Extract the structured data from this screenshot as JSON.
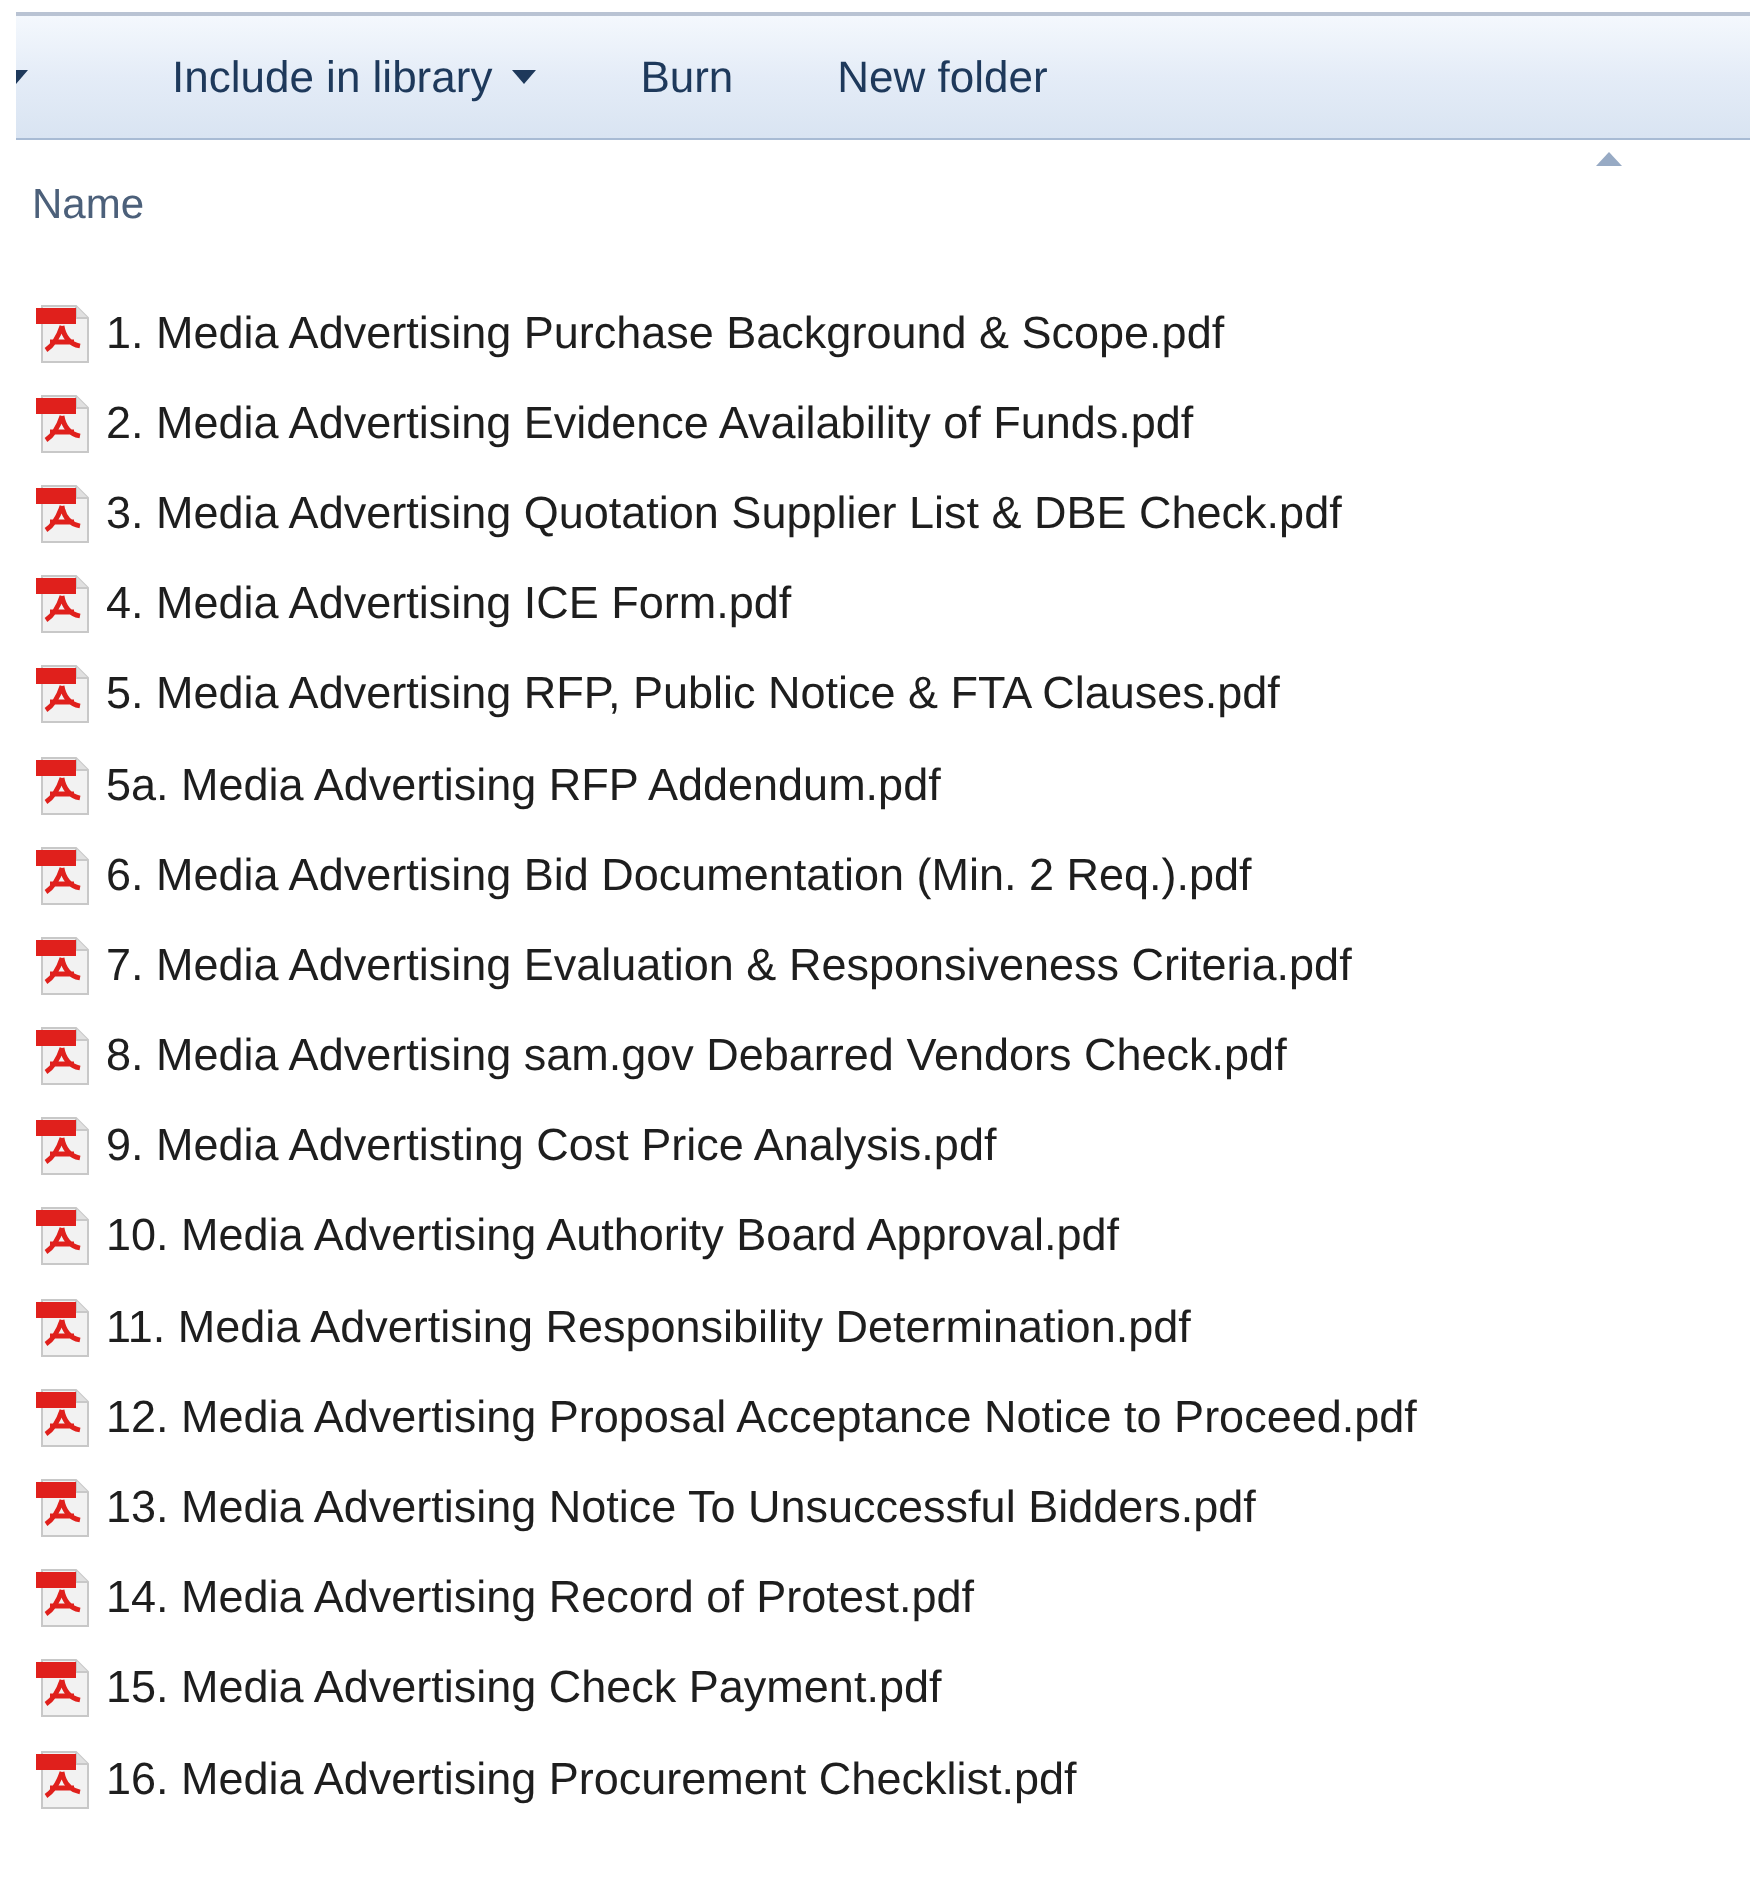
{
  "toolbar": {
    "items": [
      {
        "label": "Include in library",
        "dropdown": true
      },
      {
        "label": "Burn",
        "dropdown": false
      },
      {
        "label": "New folder",
        "dropdown": false
      }
    ]
  },
  "list": {
    "columns": [
      {
        "label": "Name",
        "sorted": true
      }
    ],
    "files": [
      {
        "name": "1. Media Advertising Purchase Background & Scope.pdf",
        "selected": false
      },
      {
        "name": "2. Media Advertising Evidence Availability of Funds.pdf",
        "selected": false
      },
      {
        "name": "3. Media Advertising Quotation Supplier List & DBE Check.pdf",
        "selected": false
      },
      {
        "name": "4. Media Advertising ICE Form.pdf",
        "selected": false
      },
      {
        "name": "5. Media Advertising RFP, Public Notice & FTA Clauses.pdf",
        "selected": false
      },
      {
        "name": "5a. Media Advertising RFP Addendum.pdf",
        "selected": false
      },
      {
        "name": "6. Media Advertising Bid Documentation (Min. 2 Req.).pdf",
        "selected": false
      },
      {
        "name": "7. Media Advertising Evaluation & Responsiveness Criteria.pdf",
        "selected": false
      },
      {
        "name": "8. Media Advertising sam.gov Debarred Vendors Check.pdf",
        "selected": false
      },
      {
        "name": "9. Media Advertisting Cost Price Analysis.pdf",
        "selected": false
      },
      {
        "name": "10. Media Advertising Authority Board Approval.pdf",
        "selected": false
      },
      {
        "name": "11. Media Advertising Responsibility Determination.pdf",
        "selected": false
      },
      {
        "name": "12. Media Advertising Proposal Acceptance Notice to Proceed.pdf",
        "selected": false
      },
      {
        "name": "13. Media Advertising Notice To Unsuccessful Bidders.pdf",
        "selected": false
      },
      {
        "name": "14. Media Advertising Record of Protest.pdf",
        "selected": false
      },
      {
        "name": "15. Media Advertising Check Payment.pdf",
        "selected": false
      },
      {
        "name": "16. Media Advertising Procurement Checklist.pdf",
        "selected": false
      }
    ]
  }
}
